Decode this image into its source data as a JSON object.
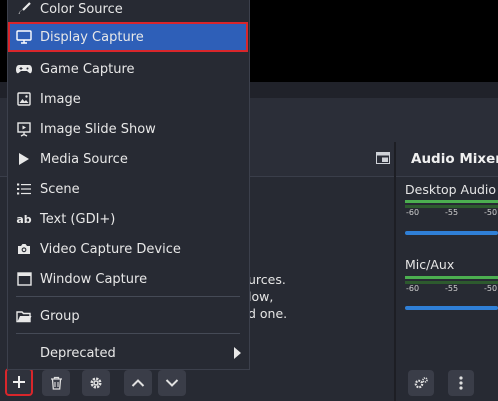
{
  "menu": {
    "items": [
      {
        "label": "Color Source",
        "icon": "brush-icon"
      },
      {
        "label": "Display Capture",
        "icon": "monitor-icon",
        "selected": true
      },
      {
        "label": "Game Capture",
        "icon": "gamepad-icon"
      },
      {
        "label": "Image",
        "icon": "image-icon"
      },
      {
        "label": "Image Slide Show",
        "icon": "slideshow-icon"
      },
      {
        "label": "Media Source",
        "icon": "play-icon"
      },
      {
        "label": "Scene",
        "icon": "list-icon"
      },
      {
        "label": "Text (GDI+)",
        "icon": "text-icon"
      },
      {
        "label": "Video Capture Device",
        "icon": "camera-icon"
      },
      {
        "label": "Window Capture",
        "icon": "window-icon"
      }
    ],
    "group_label": "Group",
    "deprecated_label": "Deprecated"
  },
  "sources": {
    "hint_lines": [
      "urces.",
      "low,",
      "d one."
    ]
  },
  "mixer": {
    "title": "Audio Mixer",
    "channels": [
      {
        "name": "Desktop Audio",
        "scale": [
          "-60",
          "-55",
          "-50"
        ]
      },
      {
        "name": "Mic/Aux",
        "scale": [
          "-60",
          "-55",
          "-50"
        ]
      }
    ]
  },
  "colors": {
    "selection": "#2e5fb8",
    "highlight_border": "#d9262b",
    "meter_green": "#4caf50",
    "fader_blue": "#2f7fd6"
  }
}
